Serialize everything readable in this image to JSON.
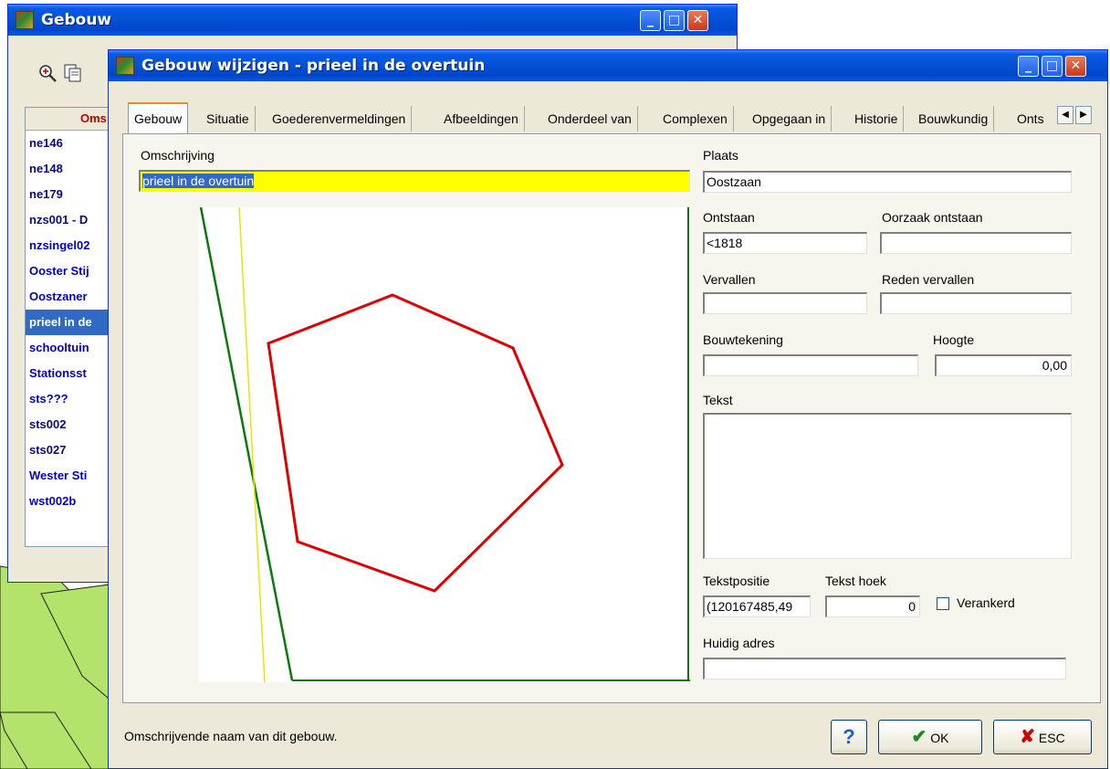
{
  "back_window": {
    "title": "Gebouw",
    "toolbar_icons": [
      "zoom-in-icon",
      "copy-icon"
    ],
    "list_header": "Oms",
    "rows": [
      {
        "text": "ne146",
        "selected": false
      },
      {
        "text": "ne148",
        "selected": false
      },
      {
        "text": "ne179",
        "selected": false
      },
      {
        "text": "nzs001 - D",
        "selected": false
      },
      {
        "text": "nzsingel02",
        "selected": false
      },
      {
        "text": "Ooster Stij",
        "selected": false
      },
      {
        "text": "Oostzaner",
        "selected": false
      },
      {
        "text": "prieel in de",
        "selected": true
      },
      {
        "text": "schooltuin",
        "selected": false
      },
      {
        "text": "Stationsst",
        "selected": false
      },
      {
        "text": "sts???",
        "selected": false
      },
      {
        "text": "sts002",
        "selected": false
      },
      {
        "text": "sts027",
        "selected": false
      },
      {
        "text": "Wester Sti",
        "selected": false
      },
      {
        "text": "wst002b",
        "selected": false
      }
    ]
  },
  "dialog": {
    "title": "Gebouw wijzigen - prieel in de overtuin",
    "window_buttons": {
      "minimize": "_",
      "maximize": "□",
      "close": "✕"
    },
    "tabs": [
      "Gebouw",
      "Situatie",
      "Goederenvermeldingen",
      "Afbeeldingen",
      "Onderdeel van",
      "Complexen",
      "Opgegaan in",
      "Historie",
      "Bouwkundig",
      "Onts"
    ],
    "active_tab": "Gebouw",
    "tab_scroll": {
      "left": "◀",
      "right": "▶"
    }
  },
  "form": {
    "omschrijving": {
      "label": "Omschrijving",
      "value": "prieel in de overtuin"
    },
    "plaats": {
      "label": "Plaats",
      "value": "Oostzaan"
    },
    "ontstaan": {
      "label": "Ontstaan",
      "value": "<1818"
    },
    "oorzaak_ontstaan": {
      "label": "Oorzaak ontstaan",
      "value": ""
    },
    "vervallen": {
      "label": "Vervallen",
      "value": ""
    },
    "reden_vervallen": {
      "label": "Reden vervallen",
      "value": ""
    },
    "bouwtekening": {
      "label": "Bouwtekening",
      "value": ""
    },
    "hoogte": {
      "label": "Hoogte",
      "value": "0,00"
    },
    "tekst": {
      "label": "Tekst",
      "value": ""
    },
    "tekstpositie": {
      "label": "Tekstpositie",
      "value": "(120167485,49"
    },
    "tekst_hoek": {
      "label": "Tekst hoek",
      "value": "0"
    },
    "verankerd": {
      "label": "Verankerd",
      "checked": false
    },
    "huidig_adres": {
      "label": "Huidig adres",
      "value": ""
    }
  },
  "status": {
    "hint": "Omschrijvende naam van dit gebouw."
  },
  "buttons": {
    "help": "?",
    "ok": "OK",
    "esc": "ESC"
  },
  "colors": {
    "polygon": "#e00000",
    "green_line": "#0a7a0a",
    "yellow_line": "#e6e600",
    "selection": "#316ac5",
    "highlight": "#ffff00"
  }
}
